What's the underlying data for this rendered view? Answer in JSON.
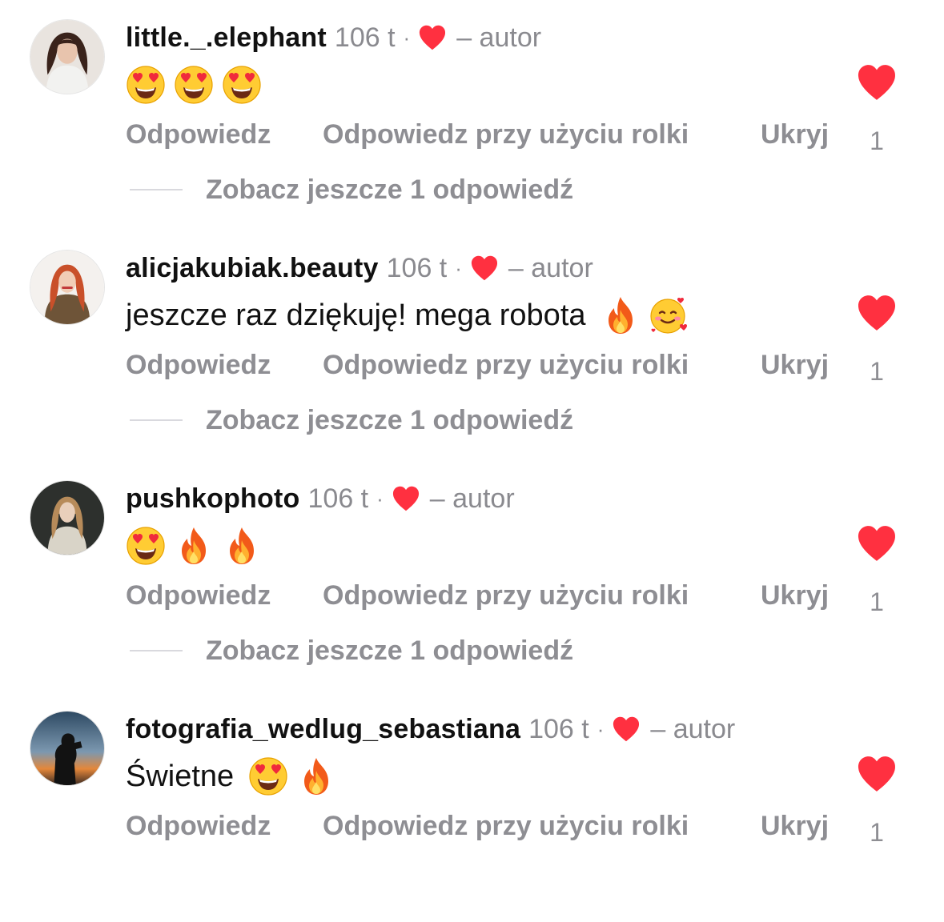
{
  "author_label": "– autor",
  "colors": {
    "heart_red": "#ff3040",
    "meta_gray": "#8a8a8f",
    "action_gray": "#8e8e93"
  },
  "comments": [
    {
      "username": "little._.elephant",
      "time": "106 t",
      "dot": "·",
      "author_label": "– autor",
      "text": "",
      "emojis": [
        "heart-eyes",
        "heart-eyes",
        "heart-eyes"
      ],
      "reply_label": "Odpowiedz",
      "reel_reply_label": "Odpowiedz przy użyciu rolki",
      "hide_label": "Ukryj",
      "like_count": "1",
      "more_replies_label": "Zobacz jeszcze 1 odpowiedź",
      "avatar_icon": "avatar-woman-dark-hair"
    },
    {
      "username": "alicjakubiak.beauty",
      "time": "106 t",
      "dot": "·",
      "author_label": "– autor",
      "text": "jeszcze raz dziękuję! mega robota",
      "emojis": [
        "fire",
        "smiling-face-with-hearts"
      ],
      "reply_label": "Odpowiedz",
      "reel_reply_label": "Odpowiedz przy użyciu rolki",
      "hide_label": "Ukryj",
      "like_count": "1",
      "more_replies_label": "Zobacz jeszcze 1 odpowiedź",
      "avatar_icon": "avatar-woman-red-hair"
    },
    {
      "username": "pushkophoto",
      "time": "106 t",
      "dot": "·",
      "author_label": "– autor",
      "text": "",
      "emojis": [
        "heart-eyes",
        "fire",
        "fire"
      ],
      "reply_label": "Odpowiedz",
      "reel_reply_label": "Odpowiedz przy użyciu rolki",
      "hide_label": "Ukryj",
      "like_count": "1",
      "more_replies_label": "Zobacz jeszcze 1 odpowiedź",
      "avatar_icon": "avatar-woman-dark-background"
    },
    {
      "username": "fotografia_wedlug_sebastiana",
      "time": "106 t",
      "dot": "·",
      "author_label": "– autor",
      "text": "Świetne",
      "emojis": [
        "heart-eyes",
        "fire"
      ],
      "reply_label": "Odpowiedz",
      "reel_reply_label": "Odpowiedz przy użyciu rolki",
      "hide_label": "Ukryj",
      "like_count": "1",
      "more_replies_label": "",
      "avatar_icon": "avatar-photographer-sunset"
    }
  ]
}
